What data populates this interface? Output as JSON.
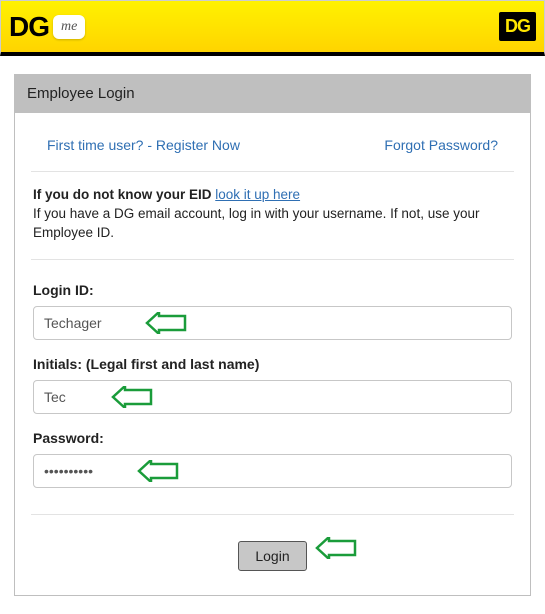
{
  "header": {
    "logo_main": "DG",
    "logo_bubble": "me",
    "logo_right": "DG"
  },
  "panel": {
    "title": "Employee Login",
    "links": {
      "register": "First time user? - Register Now",
      "forgot": "Forgot Password?"
    },
    "info": {
      "eid_prefix": "If you do not know your EID ",
      "eid_link": "look it up here",
      "instructions": "If you have a DG email account, log in with your username. If not, use your Employee ID."
    },
    "form": {
      "login_label": "Login ID:",
      "login_value": "Techager",
      "initials_label": "Initials: (Legal first and last name)",
      "initials_value": "Tec",
      "password_label": "Password:",
      "password_value": "••••••••••"
    },
    "button": {
      "login": "Login"
    }
  }
}
